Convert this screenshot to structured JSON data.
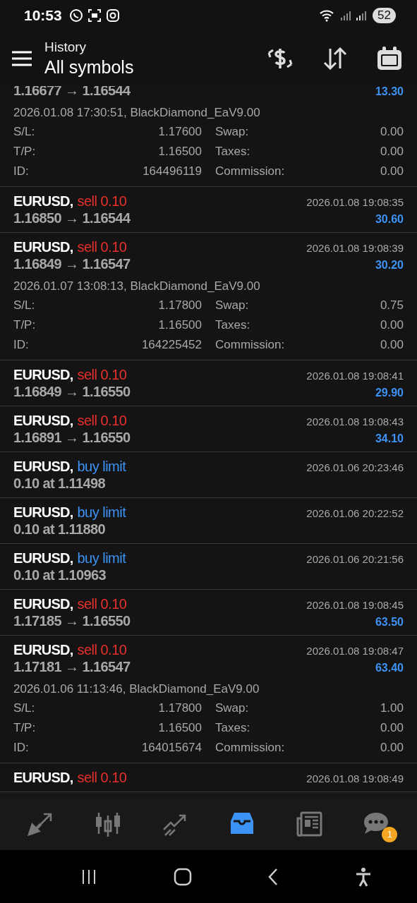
{
  "status_bar": {
    "time": "10:53",
    "battery": "52"
  },
  "header": {
    "title": "History",
    "subtitle": "All symbols"
  },
  "rows": [
    {
      "prices": "1.16677 → 1.16544",
      "profit": "13.30",
      "details": {
        "info": "2026.01.08 17:30:51, BlackDiamond_EaV9.00",
        "fields": [
          {
            "label": "S/L:",
            "value": "1.17600"
          },
          {
            "label": "Swap:",
            "value": "0.00"
          },
          {
            "label": "T/P:",
            "value": "1.16500"
          },
          {
            "label": "Taxes:",
            "value": "0.00"
          },
          {
            "label": "ID:",
            "value": "164496119"
          },
          {
            "label": "Commission:",
            "value": "0.00"
          }
        ]
      }
    },
    {
      "symbol": "EURUSD,",
      "kind": "sell",
      "action": "sell 0.10",
      "time": "2026.01.08 19:08:35",
      "prices": "1.16850 → 1.16544",
      "profit": "30.60"
    },
    {
      "symbol": "EURUSD,",
      "kind": "sell",
      "action": "sell 0.10",
      "time": "2026.01.08 19:08:39",
      "prices": "1.16849 → 1.16547",
      "profit": "30.20",
      "details": {
        "info": "2026.01.07 13:08:13, BlackDiamond_EaV9.00",
        "fields": [
          {
            "label": "S/L:",
            "value": "1.17800"
          },
          {
            "label": "Swap:",
            "value": "0.75"
          },
          {
            "label": "T/P:",
            "value": "1.16500"
          },
          {
            "label": "Taxes:",
            "value": "0.00"
          },
          {
            "label": "ID:",
            "value": "164225452"
          },
          {
            "label": "Commission:",
            "value": "0.00"
          }
        ]
      }
    },
    {
      "symbol": "EURUSD,",
      "kind": "sell",
      "action": "sell 0.10",
      "time": "2026.01.08 19:08:41",
      "prices": "1.16849 → 1.16550",
      "profit": "29.90"
    },
    {
      "symbol": "EURUSD,",
      "kind": "sell",
      "action": "sell 0.10",
      "time": "2026.01.08 19:08:43",
      "prices": "1.16891 → 1.16550",
      "profit": "34.10"
    },
    {
      "symbol": "EURUSD,",
      "kind": "buy",
      "action": "buy limit",
      "time": "2026.01.06 20:23:46",
      "prices": "0.10 at 1.11498"
    },
    {
      "symbol": "EURUSD,",
      "kind": "buy",
      "action": "buy limit",
      "time": "2026.01.06 20:22:52",
      "prices": "0.10 at 1.11880"
    },
    {
      "symbol": "EURUSD,",
      "kind": "buy",
      "action": "buy limit",
      "time": "2026.01.06 20:21:56",
      "prices": "0.10 at 1.10963"
    },
    {
      "symbol": "EURUSD,",
      "kind": "sell",
      "action": "sell 0.10",
      "time": "2026.01.08 19:08:45",
      "prices": "1.17185 → 1.16550",
      "profit": "63.50"
    },
    {
      "symbol": "EURUSD,",
      "kind": "sell",
      "action": "sell 0.10",
      "time": "2026.01.08 19:08:47",
      "prices": "1.17181 → 1.16547",
      "profit": "63.40",
      "details": {
        "info": "2026.01.06 11:13:46, BlackDiamond_EaV9.00",
        "fields": [
          {
            "label": "S/L:",
            "value": "1.17800"
          },
          {
            "label": "Swap:",
            "value": "1.00"
          },
          {
            "label": "T/P:",
            "value": "1.16500"
          },
          {
            "label": "Taxes:",
            "value": "0.00"
          },
          {
            "label": "ID:",
            "value": "164015674"
          },
          {
            "label": "Commission:",
            "value": "0.00"
          }
        ]
      }
    },
    {
      "symbol": "EURUSD,",
      "kind": "sell",
      "action": "sell 0.10",
      "time": "2026.01.08 19:08:49"
    }
  ],
  "nav": [
    {
      "kind": "trade",
      "selected": false
    },
    {
      "kind": "quotes",
      "selected": false
    },
    {
      "kind": "chart",
      "selected": false
    },
    {
      "kind": "history",
      "selected": true
    },
    {
      "kind": "news",
      "selected": false
    },
    {
      "kind": "chat",
      "selected": false,
      "badge": "1"
    }
  ]
}
